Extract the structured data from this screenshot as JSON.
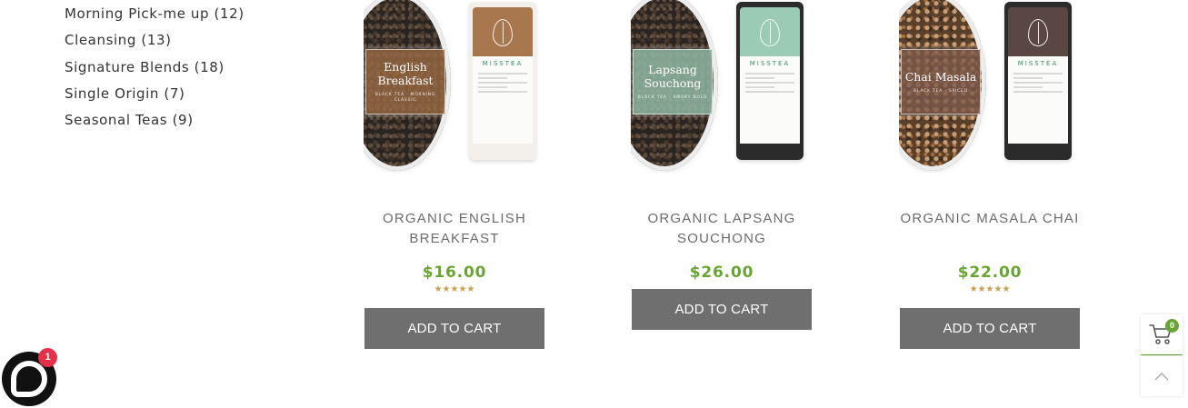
{
  "categories": [
    {
      "label": "Morning Pick-me up",
      "count": "12"
    },
    {
      "label": "Cleansing",
      "count": "13"
    },
    {
      "label": "Signature Blends",
      "count": "18"
    },
    {
      "label": "Single Origin",
      "count": "7"
    },
    {
      "label": "Seasonal Teas",
      "count": "9"
    }
  ],
  "products": [
    {
      "name": "Organic English Breakfast",
      "price": "$16.00",
      "rating": 5,
      "button": "ADD TO CART",
      "image_label_main": "English Breakfast",
      "image_label_sub": "BLACK TEA · MORNING CLASSIC",
      "tin_brand": "MISSTEA",
      "panel_color": "#9a6a42",
      "tin_color": "#a8774e"
    },
    {
      "name": "Organic Lapsang Souchong",
      "price": "$26.00",
      "rating": 5,
      "button": "ADD TO CART",
      "image_label_main": "Lapsang Souchong",
      "image_label_sub": "BLACK TEA · SMOKY BOLD",
      "tin_brand": "MISSTEA",
      "panel_color": "#8fb7a2",
      "tin_color": "#9ccbb5"
    },
    {
      "name": "Organic Masala Chai",
      "price": "$22.00",
      "rating": 5,
      "button": "ADD TO CART",
      "image_label_main": "Chai Masala",
      "image_label_sub": "BLACK TEA · SPICED",
      "tin_brand": "MISSTEA",
      "panel_color": "#7d5a4c",
      "tin_color": "#5a4642"
    }
  ],
  "chat": {
    "badge": "1"
  },
  "cart": {
    "count": "0"
  },
  "icons": {
    "star": "star-icon",
    "chat": "chat-bubble-icon",
    "cart": "shopping-cart-icon",
    "scroll_top": "chevron-up-icon"
  },
  "colors": {
    "price": "#69a532",
    "button_bg": "#6f6f6f",
    "star": "#c8a04f",
    "badge_red": "#e5304a"
  }
}
